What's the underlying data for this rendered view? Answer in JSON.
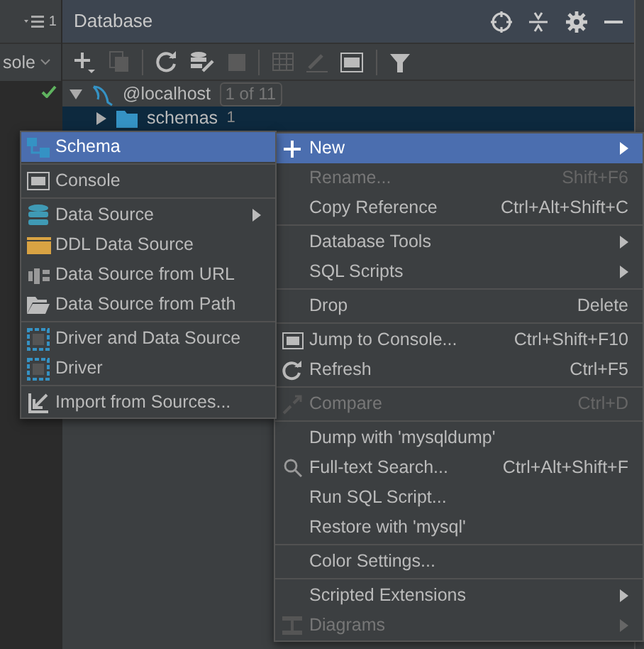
{
  "left_strip": {
    "counter": "1",
    "console_tab": "sole"
  },
  "panel": {
    "title": "Database"
  },
  "tree": [
    {
      "label": "@localhost",
      "badge": "1 of 11",
      "expanded": true,
      "connected": true,
      "selected": false
    },
    {
      "label": "schemas",
      "count": "1",
      "expanded": false,
      "selected": true
    }
  ],
  "new_submenu": [
    {
      "kind": "item",
      "label": "Schema",
      "selected": true,
      "submenu": false,
      "disabled": false
    },
    {
      "kind": "separator"
    },
    {
      "kind": "item",
      "label": "Console",
      "selected": false,
      "submenu": false,
      "disabled": false
    },
    {
      "kind": "separator"
    },
    {
      "kind": "item",
      "label": "Data Source",
      "selected": false,
      "submenu": true,
      "disabled": false
    },
    {
      "kind": "item",
      "label": "DDL Data Source",
      "selected": false,
      "submenu": false,
      "disabled": false
    },
    {
      "kind": "item",
      "label": "Data Source from URL",
      "selected": false,
      "submenu": false,
      "disabled": false
    },
    {
      "kind": "item",
      "label": "Data Source from Path",
      "selected": false,
      "submenu": false,
      "disabled": false
    },
    {
      "kind": "separator"
    },
    {
      "kind": "item",
      "label": "Driver and Data Source",
      "selected": false,
      "submenu": false,
      "disabled": false
    },
    {
      "kind": "item",
      "label": "Driver",
      "selected": false,
      "submenu": false,
      "disabled": false
    },
    {
      "kind": "separator"
    },
    {
      "kind": "item",
      "label": "Import from Sources...",
      "selected": false,
      "submenu": false,
      "disabled": false
    }
  ],
  "context_menu": [
    {
      "kind": "item",
      "label": "New",
      "selected": true,
      "submenu": true,
      "disabled": false
    },
    {
      "kind": "item",
      "label": "Rename...",
      "shortcut": "Shift+F6",
      "selected": false,
      "submenu": false,
      "disabled": true
    },
    {
      "kind": "item",
      "label": "Copy Reference",
      "shortcut": "Ctrl+Alt+Shift+C",
      "selected": false,
      "submenu": false,
      "disabled": false
    },
    {
      "kind": "separator"
    },
    {
      "kind": "item",
      "label": "Database Tools",
      "selected": false,
      "submenu": true,
      "disabled": false
    },
    {
      "kind": "item",
      "label": "SQL Scripts",
      "selected": false,
      "submenu": true,
      "disabled": false
    },
    {
      "kind": "separator"
    },
    {
      "kind": "item",
      "label": "Drop",
      "shortcut": "Delete",
      "selected": false,
      "submenu": false,
      "disabled": false
    },
    {
      "kind": "separator"
    },
    {
      "kind": "item",
      "label": "Jump to Console...",
      "shortcut": "Ctrl+Shift+F10",
      "selected": false,
      "submenu": false,
      "disabled": false
    },
    {
      "kind": "item",
      "label": "Refresh",
      "shortcut": "Ctrl+F5",
      "selected": false,
      "submenu": false,
      "disabled": false
    },
    {
      "kind": "separator"
    },
    {
      "kind": "item",
      "label": "Compare",
      "shortcut": "Ctrl+D",
      "selected": false,
      "submenu": false,
      "disabled": true
    },
    {
      "kind": "separator"
    },
    {
      "kind": "item",
      "label": "Dump with 'mysqldump'",
      "selected": false,
      "submenu": false,
      "disabled": false
    },
    {
      "kind": "item",
      "label": "Full-text Search...",
      "shortcut": "Ctrl+Alt+Shift+F",
      "selected": false,
      "submenu": false,
      "disabled": false
    },
    {
      "kind": "item",
      "label": "Run SQL Script...",
      "selected": false,
      "submenu": false,
      "disabled": false
    },
    {
      "kind": "item",
      "label": "Restore with 'mysql'",
      "selected": false,
      "submenu": false,
      "disabled": false
    },
    {
      "kind": "separator"
    },
    {
      "kind": "item",
      "label": "Color Settings...",
      "selected": false,
      "submenu": false,
      "disabled": false
    },
    {
      "kind": "separator"
    },
    {
      "kind": "item",
      "label": "Scripted Extensions",
      "selected": false,
      "submenu": true,
      "disabled": false
    },
    {
      "kind": "item",
      "label": "Diagrams",
      "selected": false,
      "submenu": true,
      "disabled": true
    }
  ]
}
